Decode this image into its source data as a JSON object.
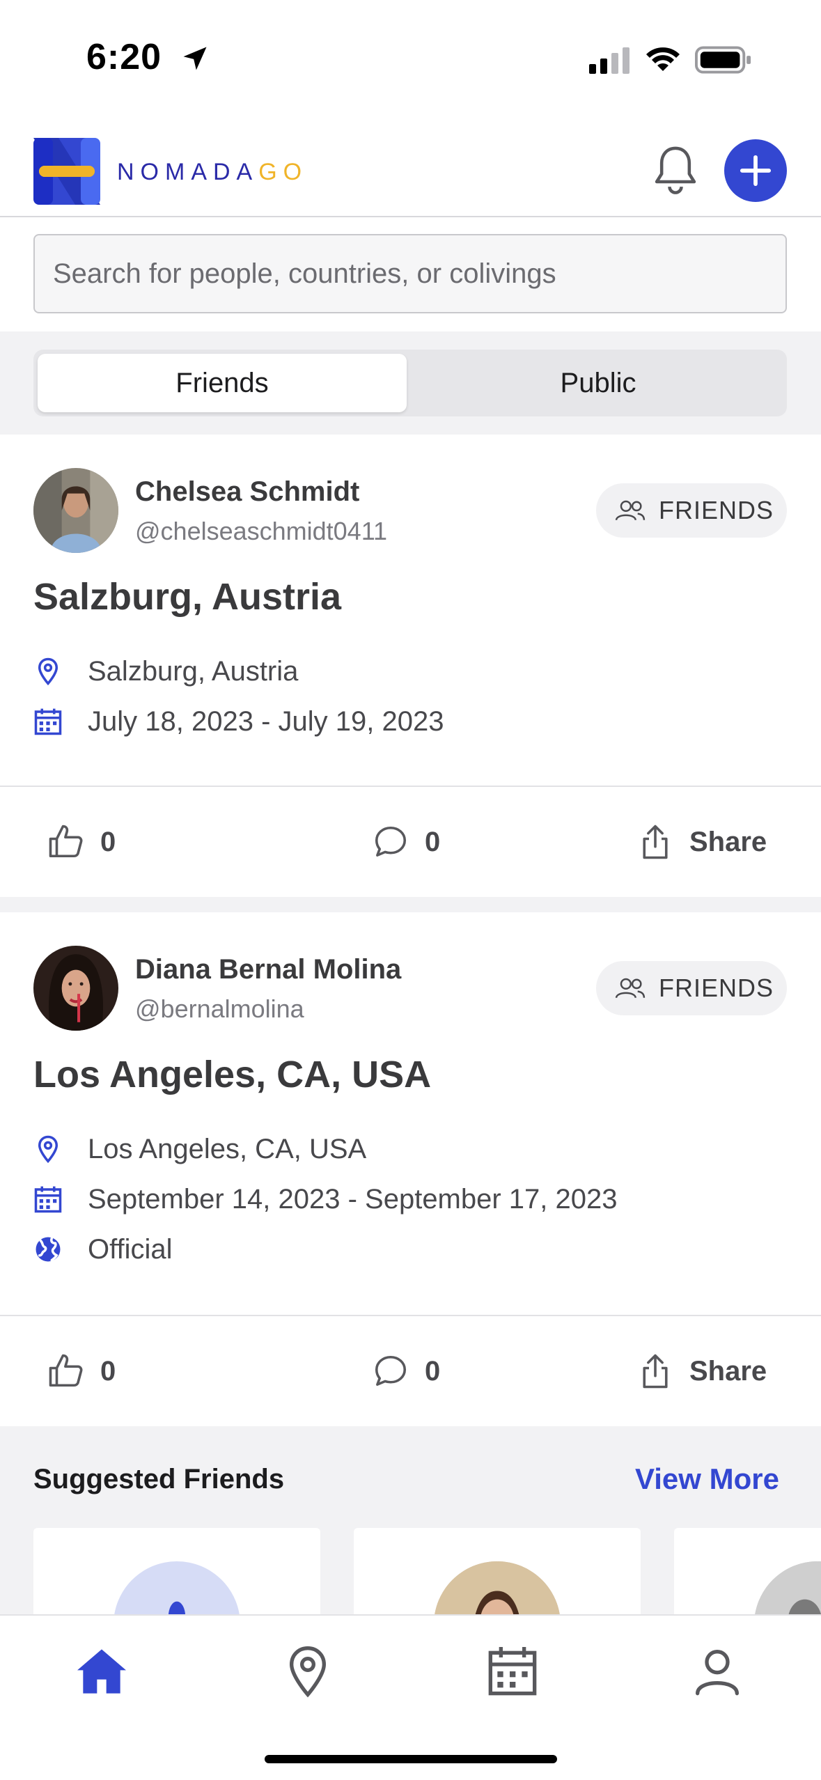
{
  "status_bar": {
    "time": "6:20"
  },
  "header": {
    "brand_main": "NOMADA",
    "brand_accent": "GO",
    "accent_color": "#3347d1"
  },
  "search": {
    "placeholder": "Search for people, countries, or colivings"
  },
  "segments": [
    {
      "label": "Friends",
      "active": true
    },
    {
      "label": "Public",
      "active": false
    }
  ],
  "posts": [
    {
      "author_name": "Chelsea Schmidt",
      "author_handle": "@chelseaschmidt0411",
      "badge": "FRIENDS",
      "title": "Salzburg, Austria",
      "location": "Salzburg, Austria",
      "dates": "July 18, 2023 - July 19, 2023",
      "likes": "0",
      "comments": "0",
      "share_label": "Share"
    },
    {
      "author_name": "Diana Bernal Molina",
      "author_handle": "@bernalmolina",
      "badge": "FRIENDS",
      "title": "Los Angeles, CA, USA",
      "location": "Los Angeles, CA, USA",
      "dates": "September 14, 2023 - September 17, 2023",
      "visibility": "Official",
      "likes": "0",
      "comments": "0",
      "share_label": "Share"
    }
  ],
  "suggested": {
    "title": "Suggested Friends",
    "view_more": "View More"
  },
  "tabbar": {
    "items": [
      "home-icon",
      "map-pin-icon",
      "calendar-icon",
      "profile-icon"
    ],
    "active_color": "#3347d1",
    "inactive_color": "#58585c"
  }
}
